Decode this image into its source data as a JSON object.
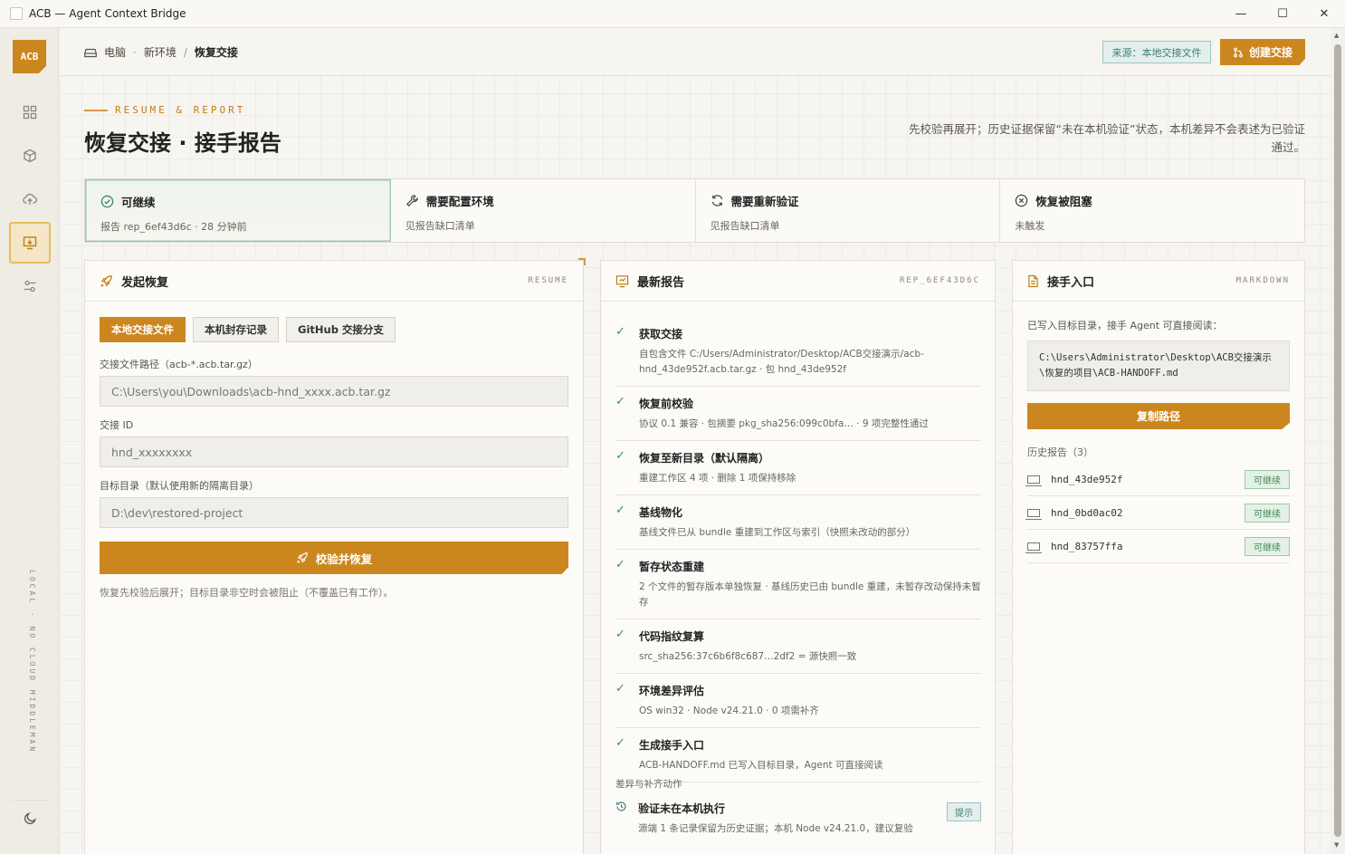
{
  "window": {
    "title": "ACB — Agent Context Bridge"
  },
  "sidebar": {
    "logo": "ACB",
    "footer_label": "LOCAL · NO CLOUD MIDDLEMAN"
  },
  "breadcrumb": {
    "root": "电脑",
    "dot": "·",
    "env": "新环境",
    "sep": "/",
    "current": "恢复交接"
  },
  "topbar": {
    "source_tag": "来源：本地交接文件",
    "create_label": "创建交接"
  },
  "header": {
    "eyebrow": "RESUME & REPORT",
    "title": "恢复交接 · 接手报告",
    "desc": "先校验再展开；历史证据保留“未在本机验证”状态，本机差异不会表述为已验证通过。"
  },
  "status": [
    {
      "title": "可继续",
      "sub": "报告 rep_6ef43d6c · 28 分钟前"
    },
    {
      "title": "需要配置环境",
      "sub": "见报告缺口清单"
    },
    {
      "title": "需要重新验证",
      "sub": "见报告缺口清单"
    },
    {
      "title": "恢复被阻塞",
      "sub": "未触发"
    }
  ],
  "resume_panel": {
    "title": "发起恢复",
    "tag": "RESUME",
    "sources": [
      "本地交接文件",
      "本机封存记录",
      "GitHub 交接分支"
    ],
    "file_label": "交接文件路径（acb-*.acb.tar.gz）",
    "file_placeholder": "C:\\Users\\you\\Downloads\\acb-hnd_xxxx.acb.tar.gz",
    "id_label": "交接 ID",
    "id_placeholder": "hnd_xxxxxxxx",
    "target_label": "目标目录（默认使用新的隔离目录）",
    "target_placeholder": "D:\\dev\\restored-project",
    "submit_label": "校验并恢复",
    "hint": "恢复先校验后展开；目标目录非空时会被阻止（不覆盖已有工作）。"
  },
  "report_panel": {
    "title": "最新报告",
    "tag": "REP_6EF43D6C",
    "steps": [
      {
        "title": "获取交接",
        "desc": "自包含文件 C:/Users/Administrator/Desktop/ACB交接演示/acb-hnd_43de952f.acb.tar.gz · 包 hnd_43de952f"
      },
      {
        "title": "恢复前校验",
        "desc": "协议 0.1 兼容 · 包摘要 pkg_sha256:099c0bfa… · 9 项完整性通过"
      },
      {
        "title": "恢复至新目录（默认隔离）",
        "desc": "重建工作区 4 项 · 删除 1 项保持移除"
      },
      {
        "title": "基线物化",
        "desc": "基线文件已从 bundle 重建到工作区与索引（快照未改动的部分）"
      },
      {
        "title": "暂存状态重建",
        "desc": "2 个文件的暂存版本单独恢复 · 基线历史已由 bundle 重建，未暂存改动保持未暂存"
      },
      {
        "title": "代码指纹复算",
        "desc": "src_sha256:37c6b6f8c687…2df2 = 源快照一致"
      },
      {
        "title": "环境差异评估",
        "desc": "OS win32 · Node v24.21.0 · 0 项需补齐"
      },
      {
        "title": "生成接手入口",
        "desc": "ACB-HANDOFF.md 已写入目标目录，Agent 可直接阅读"
      }
    ],
    "diff_label": "差异与补齐动作",
    "diff": {
      "title": "验证未在本机执行",
      "desc": "源端 1 条记录保留为历史证据；本机 Node v24.21.0，建议复验",
      "badge": "提示"
    }
  },
  "handoff_panel": {
    "title": "接手入口",
    "tag": "MARKDOWN",
    "note": "已写入目标目录，接手 Agent 可直接阅读：",
    "path": "C:\\Users\\Administrator\\Desktop\\ACB交接演示\\恢复的项目\\ACB-HANDOFF.md",
    "copy_label": "复制路径",
    "history_label": "历史报告（3）",
    "history": [
      {
        "name": "hnd_43de952f",
        "status": "可继续"
      },
      {
        "name": "hnd_0bd0ac02",
        "status": "可继续"
      },
      {
        "name": "hnd_83757ffa",
        "status": "可继续"
      }
    ]
  },
  "colors": {
    "accent": "#cc861e",
    "success": "#3c8a63",
    "info": "#3e7b78"
  }
}
